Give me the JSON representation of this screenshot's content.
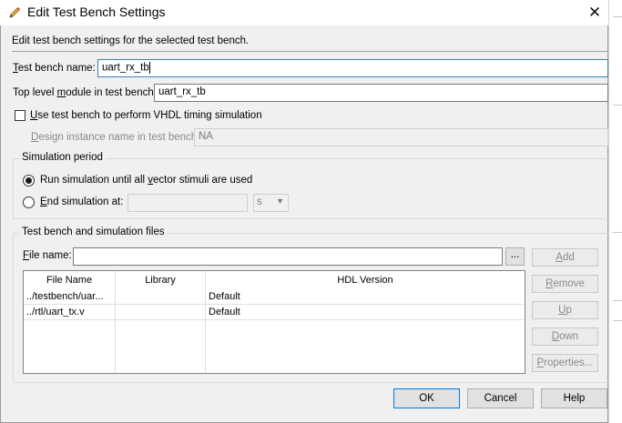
{
  "window": {
    "title": "Edit Test Bench Settings",
    "icon": "pencil-icon"
  },
  "intro": "Edit test bench settings for the selected test bench.",
  "test_bench_name": {
    "label_pre": "",
    "label_u": "T",
    "label_post": "est bench name:",
    "value": "uart_rx_tb"
  },
  "top_level_module": {
    "label_pre": "Top level ",
    "label_u": "m",
    "label_post": "odule in test bench:",
    "value": "uart_rx_tb"
  },
  "vhdl_timing": {
    "label_pre": "",
    "label_u": "U",
    "label_post": "se test bench to perform VHDL timing simulation",
    "checked": false
  },
  "design_instance": {
    "label_pre": "",
    "label_u": "D",
    "label_post": "esign instance name in test bench:",
    "value": "NA"
  },
  "simulation_period": {
    "title": "Simulation period",
    "run_until": {
      "label_pre": "Run simulation until all ",
      "label_u": "v",
      "label_post": "ector stimuli are used",
      "selected": true
    },
    "end_at": {
      "label_pre": "",
      "label_u": "E",
      "label_post": "nd simulation at:",
      "selected": false,
      "value": "",
      "unit": "s"
    }
  },
  "files": {
    "title": "Test bench and simulation files",
    "file_name": {
      "label_pre": "",
      "label_u": "F",
      "label_post": "ile name:",
      "value": ""
    },
    "browse_label": "...",
    "columns": [
      "File Name",
      "Library",
      "HDL Version"
    ],
    "rows": [
      [
        "../testbench/uar...",
        "",
        "Default"
      ],
      [
        "../rtl/uart_tx.v",
        "",
        "Default"
      ]
    ],
    "buttons": {
      "add": {
        "pre": "",
        "u": "A",
        "post": "dd"
      },
      "remove": {
        "pre": "",
        "u": "R",
        "post": "emove"
      },
      "up": {
        "pre": "",
        "u": "U",
        "post": "p"
      },
      "down": {
        "pre": "",
        "u": "D",
        "post": "own"
      },
      "properties": {
        "pre": "",
        "u": "P",
        "post": "roperties..."
      }
    }
  },
  "footer": {
    "ok": "OK",
    "cancel": "Cancel",
    "help": "Help"
  }
}
